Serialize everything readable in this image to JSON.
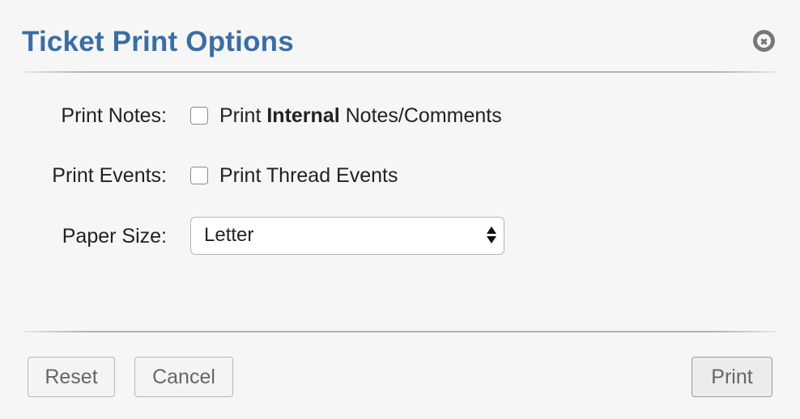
{
  "dialog": {
    "title": "Ticket Print Options"
  },
  "form": {
    "notes": {
      "label": "Print Notes:",
      "option_prefix": "Print",
      "option_bold": "Internal",
      "option_suffix": "Notes/Comments",
      "checked": false
    },
    "events": {
      "label": "Print Events:",
      "option_label": "Print Thread Events",
      "checked": false
    },
    "paper": {
      "label": "Paper Size:",
      "selected": "Letter"
    }
  },
  "buttons": {
    "reset": "Reset",
    "cancel": "Cancel",
    "print": "Print"
  },
  "icons": {
    "close": "close-circle-icon",
    "select_arrows": "updown-arrows-icon"
  },
  "colors": {
    "title": "#3a6ea5",
    "background": "#f6f6f6"
  }
}
